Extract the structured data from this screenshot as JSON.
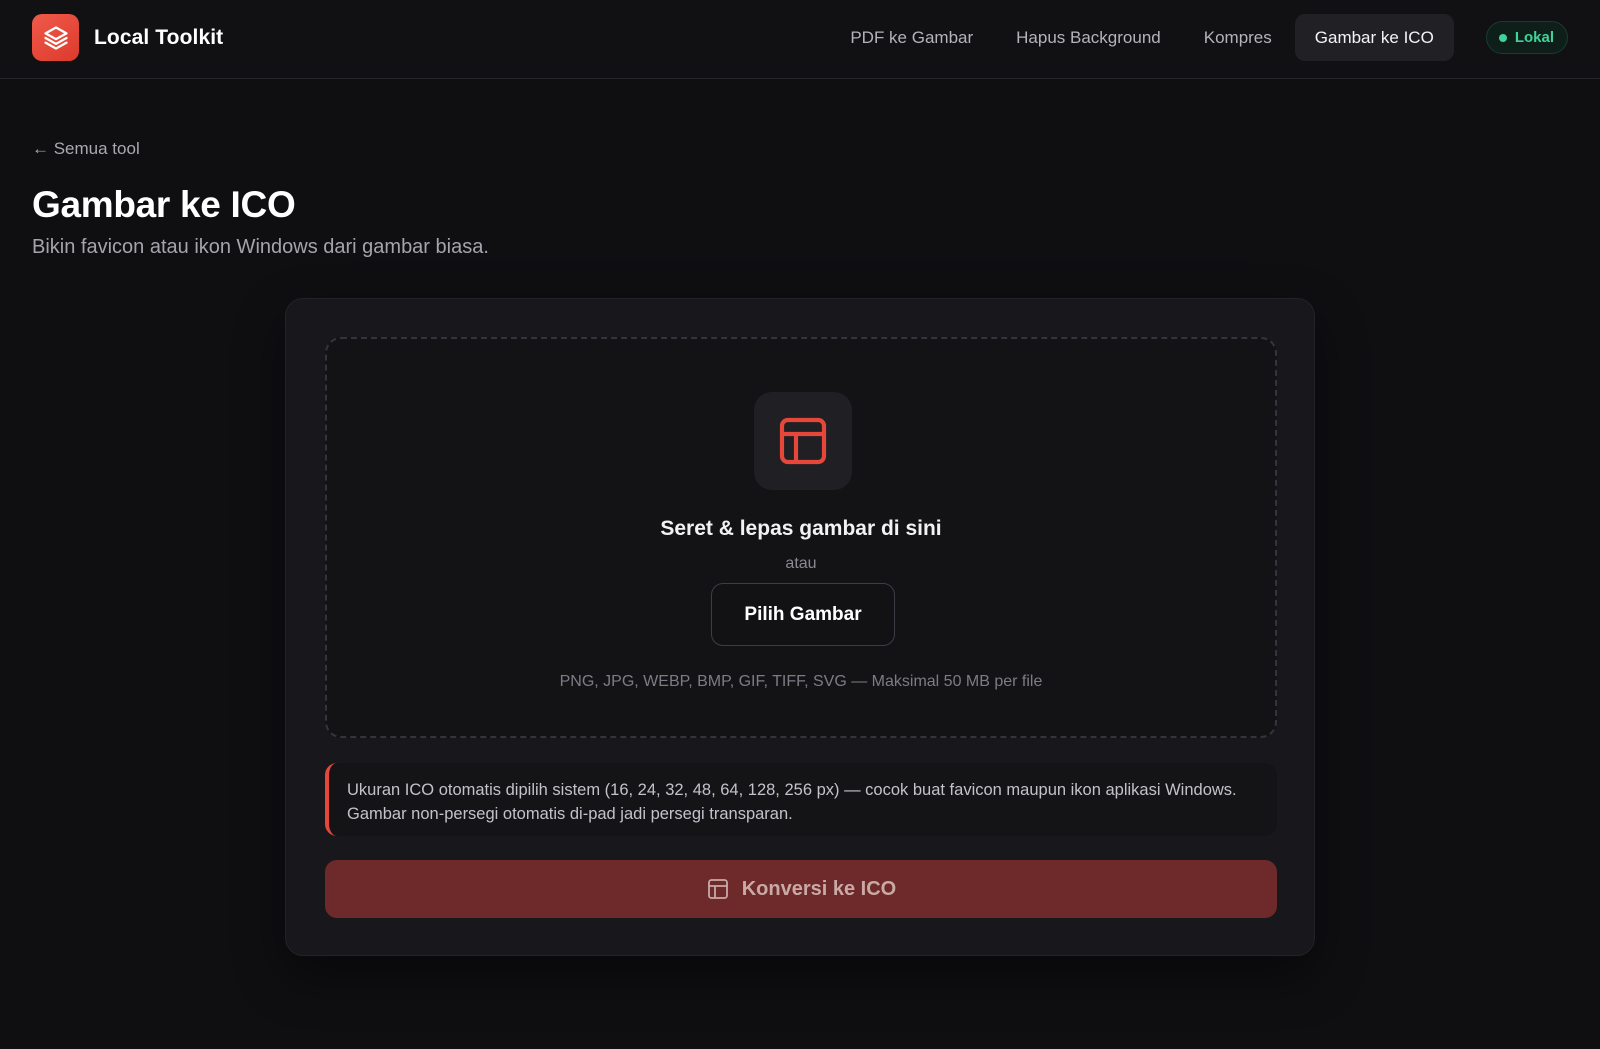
{
  "app": {
    "name": "Local Toolkit",
    "logo_icon": "layers-icon",
    "accent_color": "#e5483a"
  },
  "nav": {
    "items": [
      {
        "label": "PDF ke Gambar",
        "active": false
      },
      {
        "label": "Hapus Background",
        "active": false
      },
      {
        "label": "Kompres",
        "active": false
      },
      {
        "label": "Gambar ke ICO",
        "active": true
      }
    ],
    "status_badge": {
      "label": "Lokal",
      "color": "#3fd29a"
    }
  },
  "page": {
    "back_label": "← Semua tool",
    "title": "Gambar ke ICO",
    "subtitle": "Bikin favicon atau ikon Windows dari gambar biasa."
  },
  "dropzone": {
    "icon": "layout-panel-icon",
    "title": "Seret & lepas gambar di sini",
    "or_label": "atau",
    "button_label": "Pilih Gambar",
    "hint": "PNG, JPG, WEBP, BMP, GIF, TIFF, SVG — Maksimal 50 MB per file"
  },
  "info": {
    "text": "Ukuran ICO otomatis dipilih sistem (16, 24, 32, 48, 64, 128, 256 px) — cocok buat favicon maupun ikon aplikasi Windows. Gambar non-persegi otomatis di-pad jadi persegi transparan."
  },
  "convert": {
    "label": "Konversi ke ICO",
    "icon": "layout-panel-icon",
    "disabled": true
  }
}
